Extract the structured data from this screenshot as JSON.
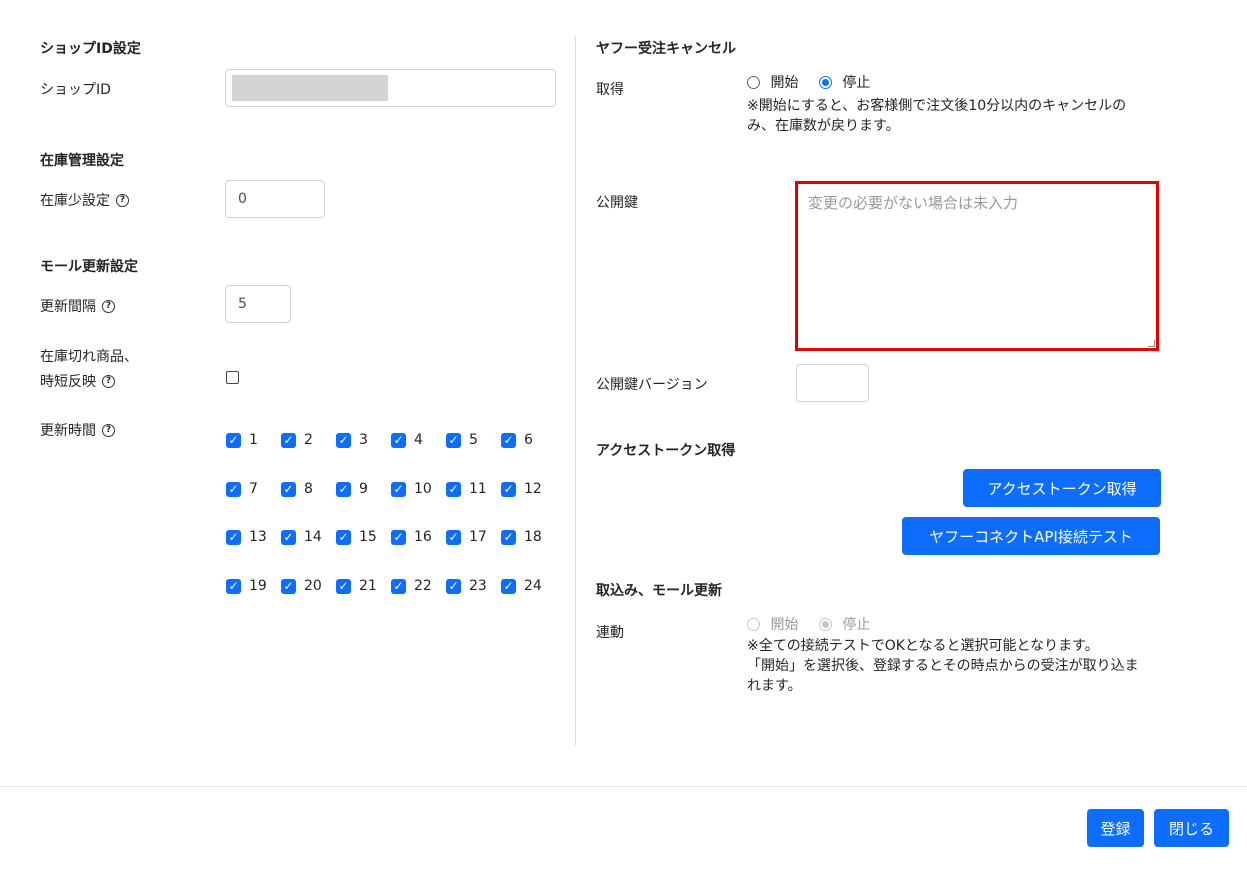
{
  "left": {
    "shop_id": {
      "heading": "ショップID設定",
      "label": "ショップID",
      "value": ""
    },
    "stock": {
      "heading": "在庫管理設定",
      "label": "在庫少設定",
      "value": "0"
    },
    "mall_update": {
      "heading": "モール更新設定",
      "interval_label": "更新間隔",
      "interval_value": "5",
      "out_of_stock_label_line1": "在庫切れ商品、",
      "out_of_stock_label_line2": "時短反映",
      "out_of_stock_checked": false,
      "time_label": "更新時間",
      "hours": [
        "1",
        "2",
        "3",
        "4",
        "5",
        "6",
        "7",
        "8",
        "9",
        "10",
        "11",
        "12",
        "13",
        "14",
        "15",
        "16",
        "17",
        "18",
        "19",
        "20",
        "21",
        "22",
        "23",
        "24"
      ],
      "hours_checked": true
    },
    "help_icon": "?"
  },
  "right": {
    "cancel": {
      "heading": "ヤフー受注キャンセル",
      "label": "取得",
      "option_start": "開始",
      "option_stop": "停止",
      "selected": "停止",
      "note_line1": "※開始にすると、お客様側で注文後10分以内のキャンセルの",
      "note_line2": "み、在庫数が戻ります。"
    },
    "public_key": {
      "label": "公開鍵",
      "placeholder": "変更の必要がない場合は未入力"
    },
    "public_key_version": {
      "label": "公開鍵バージョン",
      "value": ""
    },
    "token": {
      "heading": "アクセストークン取得",
      "get_button": "アクセストークン取得",
      "test_button": "ヤフーコネクトAPI接続テスト"
    },
    "import": {
      "heading": "取込み、モール更新",
      "label": "連動",
      "option_start": "開始",
      "option_stop": "停止",
      "selected": "停止",
      "note_line1": "※全ての接続テストでOKとなると選択可能となります。",
      "note_line2": "「開始」を選択後、登録するとその時点からの受注が取り込ま",
      "note_line3": "れます。"
    }
  },
  "footer": {
    "register_button": "登録",
    "close_button": "閉じる"
  },
  "colors": {
    "primary": "#0d6efd",
    "highlight_border": "#e00000"
  }
}
